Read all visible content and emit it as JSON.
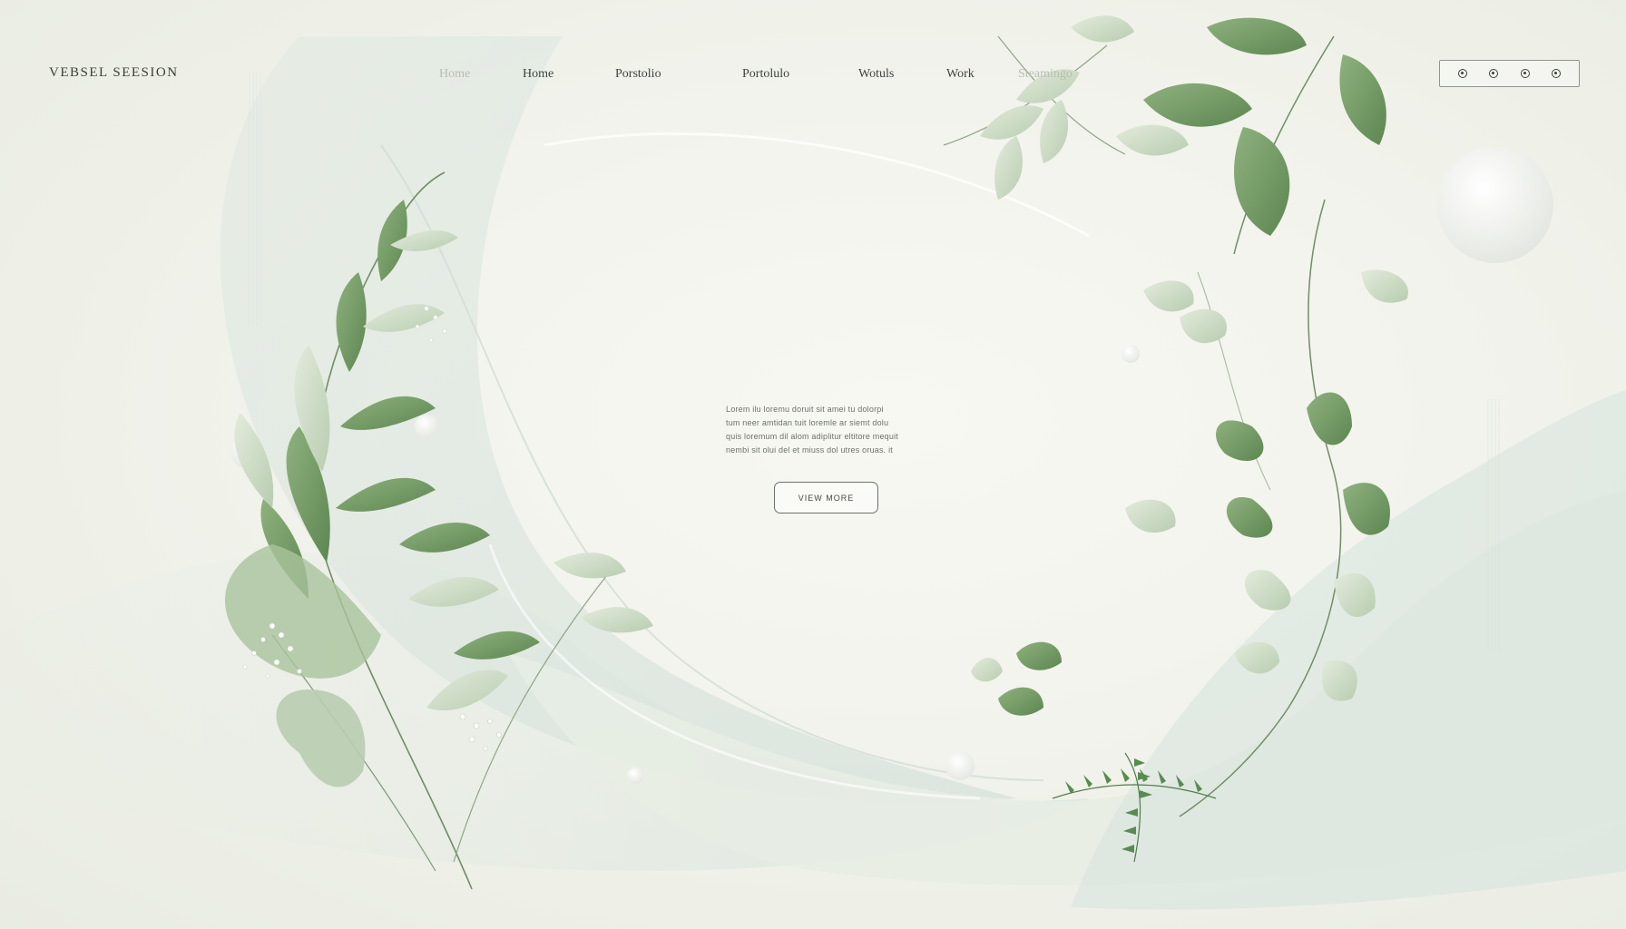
{
  "header": {
    "brand": "VEBSEL SEESION",
    "nav": [
      {
        "label": "Home",
        "faded": true
      },
      {
        "label": "Home",
        "faded": false
      },
      {
        "label": "Porstolio",
        "faded": false
      },
      {
        "label": "Portolulo",
        "faded": false
      },
      {
        "label": "Wotuls",
        "faded": false
      },
      {
        "label": "Work",
        "faded": false
      },
      {
        "label": "Steamingo",
        "faded": true
      }
    ],
    "icons": [
      "social-icon-1",
      "social-icon-2",
      "social-icon-3",
      "social-icon-4"
    ]
  },
  "hero": {
    "intro_lines": [
      "Lorem ilu loremu doruit sit amei tu dolorpi",
      "tum neer amtidan tuit loremle ar siemt dolu",
      "quis loremum dil alom adiplitur eltitore mequit",
      "nembi sit olui del et miuss dol utres oruas. it"
    ],
    "cta_label": "VIEW MORE"
  },
  "colors": {
    "leaf_dark": "#6f9a62",
    "leaf_light": "#c9d8c0",
    "wave": "#cfe0d8",
    "background": "#f1f1ea"
  }
}
